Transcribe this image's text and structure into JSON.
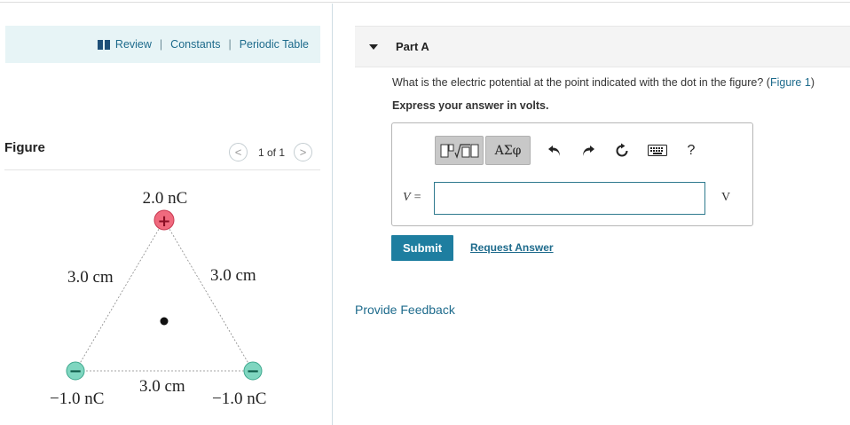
{
  "resources": {
    "review": "Review",
    "separator": "|",
    "constants": "Constants",
    "periodic_table": "Periodic Table"
  },
  "figure": {
    "label": "Figure",
    "pager_text": "1 of 1",
    "prev_glyph": "<",
    "next_glyph": ">",
    "top_charge": "2.0 nC",
    "left_charge": "−1.0 nC",
    "right_charge": "−1.0 nC",
    "left_side": "3.0 cm",
    "right_side": "3.0 cm",
    "bottom_side": "3.0 cm",
    "plus_sign": "+",
    "minus_sign": "−"
  },
  "part": {
    "title": "Part A",
    "question_prefix": "What is the electric potential at the point indicated with the dot in the figure? (",
    "question_link": "Figure 1",
    "question_suffix": ")",
    "instruction": "Express your answer in volts."
  },
  "answer": {
    "variable": "V =",
    "value": "",
    "units": "V",
    "symbols_label": "ΑΣφ",
    "help_label": "?"
  },
  "actions": {
    "submit": "Submit",
    "request_answer": "Request Answer",
    "feedback": "Provide Feedback"
  },
  "colors": {
    "accent": "#1e7ea0",
    "link": "#1e6b8c",
    "positive_charge": "#f06a7e",
    "negative_charge": "#7fd6c0"
  }
}
